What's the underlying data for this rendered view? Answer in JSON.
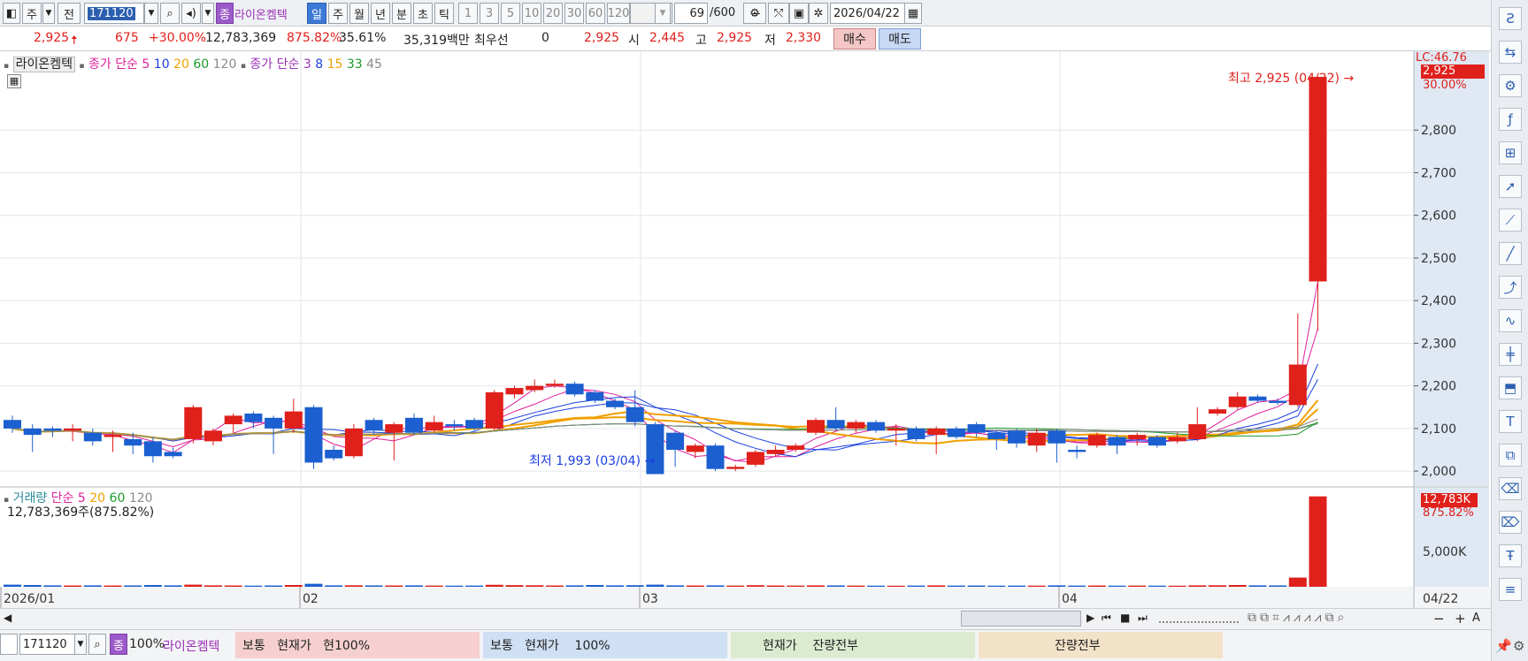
{
  "toolbar": {
    "unit_label": "주",
    "prev_label": "전",
    "code": "171120",
    "stock_badge": "종",
    "stock_name": "라이온켐텍",
    "periods": [
      "일",
      "주",
      "월",
      "년",
      "분",
      "초",
      "틱"
    ],
    "ticks": [
      "1",
      "3",
      "5",
      "10",
      "20",
      "30",
      "60",
      "120"
    ],
    "count": "69",
    "count_max": "/600",
    "date": "2026/04/22"
  },
  "quote": {
    "price": "2,925",
    "change": "675",
    "change_pct": "+30.00%",
    "volume": "12,783,369",
    "vol_ratio": "875.82%",
    "turnover": "35.61%",
    "amount": "35,319백만",
    "preferred_label": "최우선",
    "preferred_value": "0",
    "last": "2,925",
    "open_label": "시",
    "open": "2,445",
    "high_label": "고",
    "high": "2,925",
    "low_label": "저",
    "low": "2,330",
    "buy_label": "매수",
    "sell_label": "매도"
  },
  "legend": {
    "stock": "라이온켐텍",
    "ma1_label": "종가 단순",
    "ma1_periods": [
      "5",
      "10",
      "20",
      "60",
      "120"
    ],
    "ma2_label": "종가 단순",
    "ma2_periods": [
      "3",
      "8",
      "15",
      "33",
      "45"
    ],
    "vol_label": "거래량",
    "vol_ma_label": "단순",
    "vol_ma_periods": [
      "5",
      "20",
      "60",
      "120"
    ],
    "vol_summary": "12,783,369주(875.82%)"
  },
  "annotations": {
    "high_note": "최고 2,925 (04/22)",
    "low_note": "최저 1,993 (03/04)",
    "lc_label": "LC:46.76",
    "price_badge": "2,925",
    "pct_badge": "30.00%",
    "vol_badge": "12,783K",
    "vol_pct_badge": "875.82%"
  },
  "chart_data": {
    "type": "candlestick",
    "price_axis": {
      "ticks": [
        "2,800",
        "2,700",
        "2,600",
        "2,500",
        "2,400",
        "2,300",
        "2,200",
        "2,100",
        "2,000"
      ],
      "ylim": [
        1965,
        2985
      ]
    },
    "volume_axis": {
      "ticks": [
        "5,000K"
      ],
      "ylim": [
        0,
        13000
      ]
    },
    "x_labels": [
      "2026/01",
      "02",
      "03",
      "04",
      "04/22"
    ],
    "candles": [
      {
        "o": 2120,
        "c": 2100,
        "h": 2130,
        "l": 2090,
        "v": 300
      },
      {
        "o": 2100,
        "c": 2085,
        "h": 2110,
        "l": 2045,
        "v": 250
      },
      {
        "o": 2100,
        "c": 2095,
        "h": 2105,
        "l": 2080,
        "v": 200
      },
      {
        "o": 2095,
        "c": 2100,
        "h": 2110,
        "l": 2070,
        "v": 180
      },
      {
        "o": 2090,
        "c": 2070,
        "h": 2100,
        "l": 2060,
        "v": 200
      },
      {
        "o": 2080,
        "c": 2085,
        "h": 2095,
        "l": 2045,
        "v": 180
      },
      {
        "o": 2075,
        "c": 2060,
        "h": 2090,
        "l": 2040,
        "v": 190
      },
      {
        "o": 2070,
        "c": 2035,
        "h": 2080,
        "l": 2020,
        "v": 250
      },
      {
        "o": 2045,
        "c": 2035,
        "h": 2055,
        "l": 2030,
        "v": 200
      },
      {
        "o": 2075,
        "c": 2150,
        "h": 2155,
        "l": 2065,
        "v": 300
      },
      {
        "o": 2070,
        "c": 2095,
        "h": 2100,
        "l": 2060,
        "v": 200
      },
      {
        "o": 2110,
        "c": 2130,
        "h": 2135,
        "l": 2090,
        "v": 180
      },
      {
        "o": 2135,
        "c": 2115,
        "h": 2140,
        "l": 2100,
        "v": 160
      },
      {
        "o": 2125,
        "c": 2100,
        "h": 2130,
        "l": 2040,
        "v": 180
      },
      {
        "o": 2100,
        "c": 2140,
        "h": 2170,
        "l": 2090,
        "v": 250
      },
      {
        "o": 2150,
        "c": 2020,
        "h": 2155,
        "l": 2005,
        "v": 420
      },
      {
        "o": 2050,
        "c": 2030,
        "h": 2060,
        "l": 2025,
        "v": 200
      },
      {
        "o": 2035,
        "c": 2100,
        "h": 2110,
        "l": 2030,
        "v": 210
      },
      {
        "o": 2120,
        "c": 2095,
        "h": 2125,
        "l": 2085,
        "v": 190
      },
      {
        "o": 2090,
        "c": 2110,
        "h": 2115,
        "l": 2025,
        "v": 180
      },
      {
        "o": 2125,
        "c": 2090,
        "h": 2135,
        "l": 2085,
        "v": 200
      },
      {
        "o": 2095,
        "c": 2115,
        "h": 2130,
        "l": 2090,
        "v": 170
      },
      {
        "o": 2110,
        "c": 2105,
        "h": 2120,
        "l": 2095,
        "v": 160
      },
      {
        "o": 2120,
        "c": 2100,
        "h": 2125,
        "l": 2095,
        "v": 170
      },
      {
        "o": 2100,
        "c": 2185,
        "h": 2190,
        "l": 2095,
        "v": 280
      },
      {
        "o": 2180,
        "c": 2195,
        "h": 2200,
        "l": 2170,
        "v": 230
      },
      {
        "o": 2190,
        "c": 2200,
        "h": 2215,
        "l": 2185,
        "v": 210
      },
      {
        "o": 2200,
        "c": 2205,
        "h": 2215,
        "l": 2195,
        "v": 180
      },
      {
        "o": 2205,
        "c": 2180,
        "h": 2210,
        "l": 2175,
        "v": 200
      },
      {
        "o": 2185,
        "c": 2165,
        "h": 2190,
        "l": 2160,
        "v": 250
      },
      {
        "o": 2165,
        "c": 2150,
        "h": 2170,
        "l": 2145,
        "v": 200
      },
      {
        "o": 2150,
        "c": 2115,
        "h": 2190,
        "l": 2105,
        "v": 220
      },
      {
        "o": 2110,
        "c": 1993,
        "h": 2115,
        "l": 1993,
        "v": 300
      },
      {
        "o": 2090,
        "c": 2050,
        "h": 2095,
        "l": 2010,
        "v": 200
      },
      {
        "o": 2045,
        "c": 2060,
        "h": 2065,
        "l": 2030,
        "v": 180
      },
      {
        "o": 2060,
        "c": 2005,
        "h": 2065,
        "l": 2000,
        "v": 200
      },
      {
        "o": 2005,
        "c": 2010,
        "h": 2015,
        "l": 2000,
        "v": 170
      },
      {
        "o": 2015,
        "c": 2045,
        "h": 2050,
        "l": 2010,
        "v": 220
      },
      {
        "o": 2040,
        "c": 2050,
        "h": 2060,
        "l": 2035,
        "v": 180
      },
      {
        "o": 2050,
        "c": 2060,
        "h": 2065,
        "l": 2045,
        "v": 170
      },
      {
        "o": 2090,
        "c": 2120,
        "h": 2125,
        "l": 2085,
        "v": 200
      },
      {
        "o": 2120,
        "c": 2100,
        "h": 2150,
        "l": 2095,
        "v": 190
      },
      {
        "o": 2100,
        "c": 2115,
        "h": 2120,
        "l": 2090,
        "v": 170
      },
      {
        "o": 2115,
        "c": 2095,
        "h": 2120,
        "l": 2090,
        "v": 160
      },
      {
        "o": 2095,
        "c": 2100,
        "h": 2110,
        "l": 2060,
        "v": 150
      },
      {
        "o": 2100,
        "c": 2075,
        "h": 2105,
        "l": 2070,
        "v": 170
      },
      {
        "o": 2085,
        "c": 2100,
        "h": 2105,
        "l": 2040,
        "v": 200
      },
      {
        "o": 2100,
        "c": 2080,
        "h": 2105,
        "l": 2075,
        "v": 170
      },
      {
        "o": 2110,
        "c": 2090,
        "h": 2115,
        "l": 2080,
        "v": 180
      },
      {
        "o": 2090,
        "c": 2075,
        "h": 2095,
        "l": 2050,
        "v": 160
      },
      {
        "o": 2095,
        "c": 2065,
        "h": 2100,
        "l": 2055,
        "v": 170
      },
      {
        "o": 2060,
        "c": 2090,
        "h": 2100,
        "l": 2045,
        "v": 160
      },
      {
        "o": 2095,
        "c": 2065,
        "h": 2100,
        "l": 2020,
        "v": 200
      },
      {
        "o": 2050,
        "c": 2045,
        "h": 2060,
        "l": 2030,
        "v": 170
      },
      {
        "o": 2060,
        "c": 2085,
        "h": 2090,
        "l": 2055,
        "v": 180
      },
      {
        "o": 2080,
        "c": 2060,
        "h": 2085,
        "l": 2040,
        "v": 160
      },
      {
        "o": 2075,
        "c": 2085,
        "h": 2090,
        "l": 2060,
        "v": 170
      },
      {
        "o": 2080,
        "c": 2060,
        "h": 2085,
        "l": 2055,
        "v": 160
      },
      {
        "o": 2070,
        "c": 2080,
        "h": 2090,
        "l": 2065,
        "v": 150
      },
      {
        "o": 2075,
        "c": 2110,
        "h": 2150,
        "l": 2070,
        "v": 200
      },
      {
        "o": 2135,
        "c": 2145,
        "h": 2150,
        "l": 2130,
        "v": 210
      },
      {
        "o": 2150,
        "c": 2175,
        "h": 2185,
        "l": 2145,
        "v": 250
      },
      {
        "o": 2175,
        "c": 2165,
        "h": 2180,
        "l": 2160,
        "v": 200
      },
      {
        "o": 2165,
        "c": 2160,
        "h": 2170,
        "l": 2155,
        "v": 190
      },
      {
        "o": 2155,
        "c": 2250,
        "h": 2370,
        "l": 2150,
        "v": 1300
      },
      {
        "o": 2445,
        "c": 2925,
        "h": 2925,
        "l": 2330,
        "v": 12783
      }
    ]
  },
  "bottom": {
    "code": "171120",
    "badge": "종",
    "zoom": "100%",
    "name": "라이온켐텍",
    "seg1": "보통   현재가   현100%",
    "seg2": "보통   현재가    100%",
    "seg3": "현재가    잔량전부",
    "seg4": "잔량전부"
  },
  "colors": {
    "up": "#e0201b",
    "down": "#1b5fd0",
    "ma5": "#e0209b",
    "ma10": "#1b3fe0",
    "ma20": "#f0a000",
    "ma60": "#1a9a2a",
    "ma120": "#8a8a8a"
  }
}
